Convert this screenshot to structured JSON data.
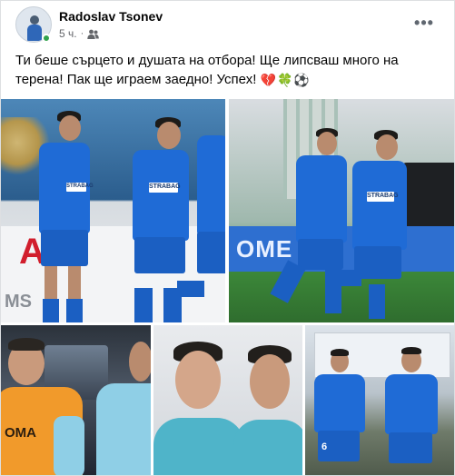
{
  "post": {
    "author": "Radoslav Tsonev",
    "time": "5 ч.",
    "separator": "·",
    "audience_icon": "friends-icon",
    "more_icon": "ellipsis-icon",
    "more_label": "•••",
    "text": "Ти беше сърцето и душата на отбора! Ще липсваш много на терена! Пак ще играем заедно! Успех!",
    "emojis": [
      "💔",
      "🍀",
      "⚽"
    ]
  },
  "photos": {
    "photo1": {
      "sponsor": "STRABAG",
      "sponsor2": "STRABAG",
      "board": "AO",
      "board_sub": "MS"
    },
    "photo2": {
      "sponsor": "STRABAG",
      "board": "OME"
    },
    "photo3": {
      "vest_text": "OMA"
    },
    "photo5": {
      "shirt_number": "6"
    }
  },
  "colors": {
    "accent": "#1f6bd6",
    "online": "#31a24c",
    "meta_text": "#65676b"
  }
}
